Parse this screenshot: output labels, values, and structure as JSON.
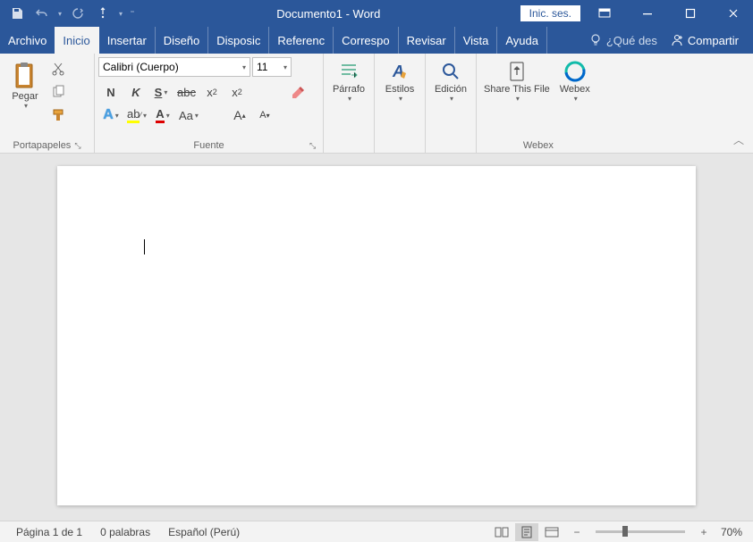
{
  "titlebar": {
    "doc_title": "Documento1",
    "app_suffix": " - Word",
    "signin": "Inic. ses."
  },
  "tabs": {
    "file": "Archivo",
    "items": [
      "Inicio",
      "Insertar",
      "Diseño",
      "Disposic",
      "Referenc",
      "Correspo",
      "Revisar",
      "Vista",
      "Ayuda"
    ],
    "active_index": 0,
    "tellme": "¿Qué des",
    "share": "Compartir"
  },
  "ribbon": {
    "clipboard": {
      "label": "Portapapeles",
      "paste": "Pegar"
    },
    "font": {
      "label": "Fuente",
      "name": "Calibri (Cuerpo)",
      "size": "11"
    },
    "paragraph": {
      "label": "Párrafo"
    },
    "styles": {
      "label": "Estilos"
    },
    "editing": {
      "label": "Edición"
    },
    "webex": {
      "label": "Webex",
      "share_file": "Share This File",
      "webex": "Webex"
    }
  },
  "statusbar": {
    "page": "Página 1 de 1",
    "words": "0 palabras",
    "lang": "Español (Perú)",
    "zoom": "70%"
  }
}
